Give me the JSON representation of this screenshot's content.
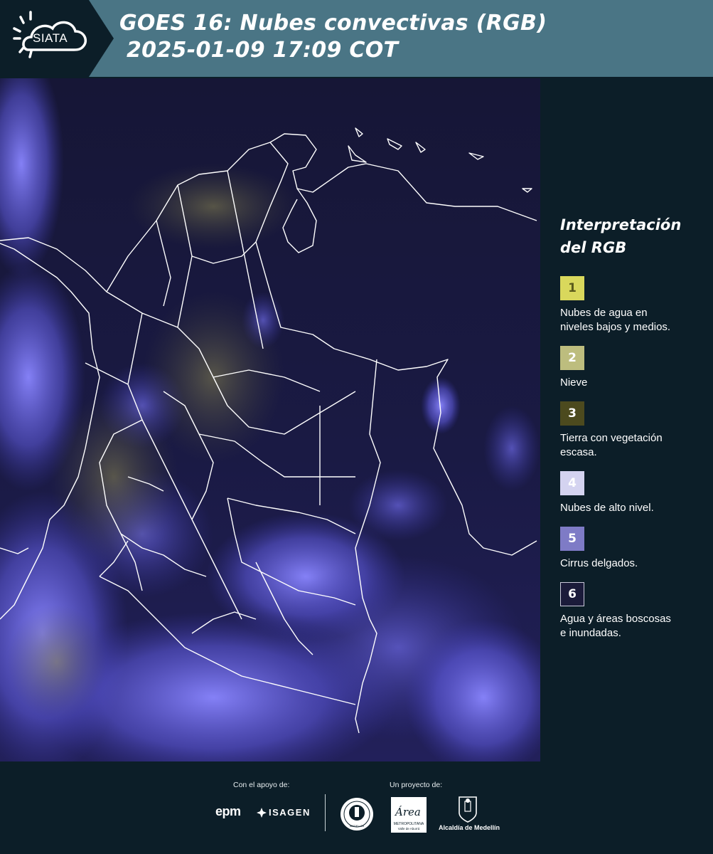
{
  "header": {
    "logo_text": "SIATA",
    "title_line1": "GOES 16: Nubes convectivas (RGB)",
    "title_line2": "2025-01-09 17:09 COT"
  },
  "legend": {
    "title_line1": "Interpretación",
    "title_line2": "del RGB",
    "items": [
      {
        "number": "1",
        "label_lines": [
          "Nubes de agua en",
          "niveles bajos y medios."
        ],
        "color": "#d9d85c",
        "text_color": "#5a5a1c"
      },
      {
        "number": "2",
        "label_lines": [
          "Nieve"
        ],
        "color": "#bdbd7e",
        "text_color": "#ffffff"
      },
      {
        "number": "3",
        "label_lines": [
          "Tierra con vegetación",
          "escasa."
        ],
        "color": "#4c4a1e",
        "text_color": "#ffffff"
      },
      {
        "number": "4",
        "label_lines": [
          "Nubes de alto nivel."
        ],
        "color": "#d4d3f0",
        "text_color": "#ffffff"
      },
      {
        "number": "5",
        "label_lines": [
          "Cirrus delgados."
        ],
        "color": "#7e7bc6",
        "text_color": "#ffffff"
      },
      {
        "number": "6",
        "label_lines": [
          "Agua y áreas boscosas",
          "e inundadas."
        ],
        "color": "#1b1b3a",
        "text_color": "#ffffff"
      }
    ]
  },
  "footer": {
    "support_label": "Con el apoyo de:",
    "project_label": "Un proyecto de:",
    "sponsors": {
      "epm": "epm",
      "isagen": "ISAGEN"
    },
    "partners": {
      "metro_title": "Área",
      "metro_line1": "METROPOLITANA",
      "metro_line2": "Valle de Aburrá",
      "alcaldia": "Alcaldía de Medellín",
      "seal_text": "MEDELLÍN"
    }
  },
  "colors": {
    "header_bg": "#4a7585",
    "logo_bg": "#0c1e28",
    "page_bg": "#0c1e28",
    "map_bg": "#141636",
    "cloud": "#6b66e8",
    "border": "#ffffff"
  }
}
